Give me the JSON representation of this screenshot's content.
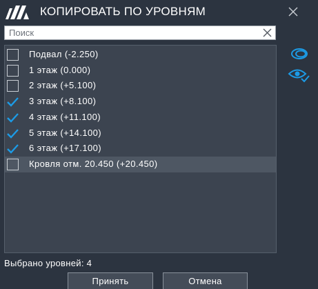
{
  "title": "КОПИРОВАТЬ ПО УРОВНЯМ",
  "search": {
    "placeholder": "Поиск",
    "value": ""
  },
  "levels": [
    {
      "label": "Подвал (-2.250)",
      "checked": false,
      "highlighted": false
    },
    {
      "label": "1 этаж (0.000)",
      "checked": false,
      "highlighted": false
    },
    {
      "label": "2 этаж (+5.100)",
      "checked": false,
      "highlighted": false
    },
    {
      "label": "3 этаж (+8.100)",
      "checked": true,
      "highlighted": false
    },
    {
      "label": "4 этаж (+11.100)",
      "checked": true,
      "highlighted": false
    },
    {
      "label": "5 этаж (+14.100)",
      "checked": true,
      "highlighted": false
    },
    {
      "label": "6 этаж (+17.100)",
      "checked": true,
      "highlighted": false
    },
    {
      "label": "Кровля отм. 20.450 (+20.450)",
      "checked": false,
      "highlighted": true
    }
  ],
  "side_icons": [
    "lasso-select-icon",
    "eye-check-icon"
  ],
  "status": "Выбрано уровней: 4",
  "buttons": {
    "accept": "Принять",
    "cancel": "Отмена"
  },
  "colors": {
    "background": "#2c3440",
    "list_background": "#3c4450",
    "highlight_row": "#4e5763",
    "accent": "#1c9be6",
    "text": "#ffffff"
  }
}
